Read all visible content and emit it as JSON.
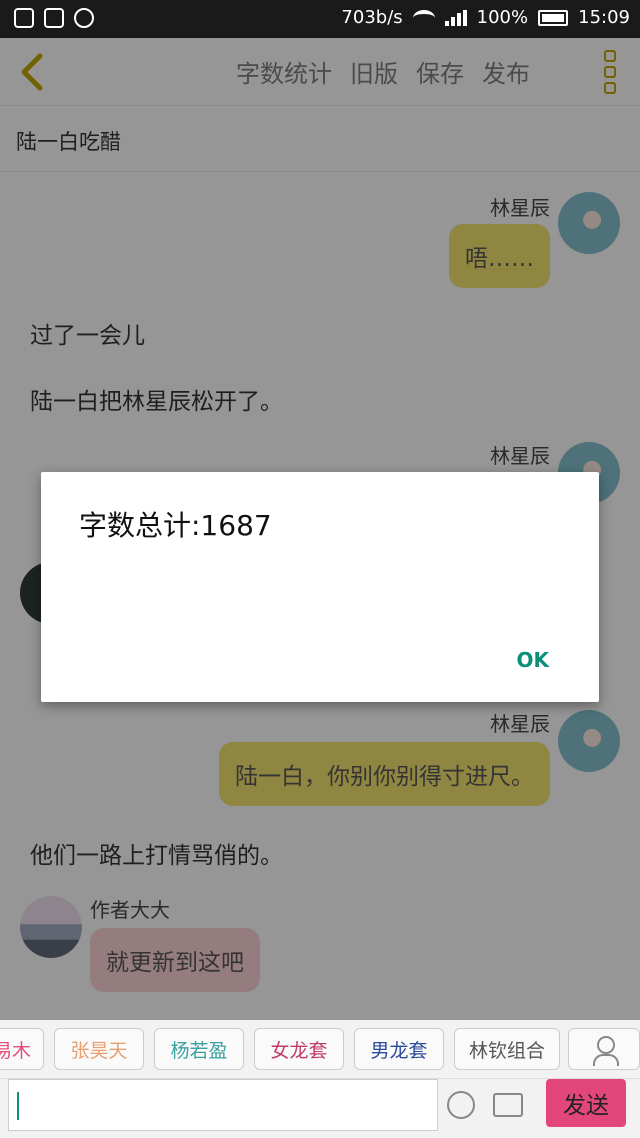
{
  "status_bar": {
    "speed": "703b/s",
    "battery": "100%",
    "time": "15:09"
  },
  "app_bar": {
    "menu": [
      "字数统计",
      "旧版",
      "保存",
      "发布"
    ]
  },
  "subtitle": "陆一白吃醋",
  "messages": {
    "m1_name": "林星辰",
    "m1_text": "唔……",
    "narr1": "过了一会儿",
    "narr2": "陆一白把林星辰松开了。",
    "m2_name": "林星辰",
    "m3_name": "林星辰",
    "m3_text": "陆一白，你别你别得寸进尺。",
    "narr3": "他们一路上打情骂俏的。",
    "m4_name": "作者大大",
    "m4_text": "就更新到这吧"
  },
  "dialog": {
    "message": "字数总计:1687",
    "ok_label": "OK"
  },
  "tags": [
    {
      "label": "易木",
      "color": "#e0507a"
    },
    {
      "label": "张昊天",
      "color": "#e8a070"
    },
    {
      "label": "杨若盈",
      "color": "#3aa0a0"
    },
    {
      "label": "女龙套",
      "color": "#c03a6a"
    },
    {
      "label": "男龙套",
      "color": "#2a4a9a"
    },
    {
      "label": "林钦组合",
      "color": "#555555"
    }
  ],
  "input_bar": {
    "send_label": "发送"
  }
}
